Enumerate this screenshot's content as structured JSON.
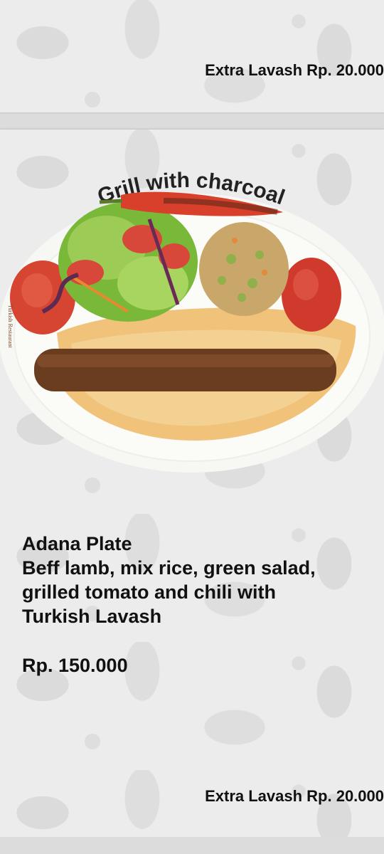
{
  "top_card": {
    "extra_lavash": "Extra Lavash Rp. 20.000"
  },
  "main_card": {
    "arc_title": "Grill with charcoal",
    "plate_brand": "Turkish Restaurant",
    "dish_name": "Adana Plate",
    "description_lines": [
      "Beff lamb, mix rice, green salad,",
      "grilled tomato and chili with",
      "Turkish Lavash"
    ],
    "price": "Rp. 150.000",
    "extra_lavash": "Extra Lavash Rp. 20.000"
  }
}
